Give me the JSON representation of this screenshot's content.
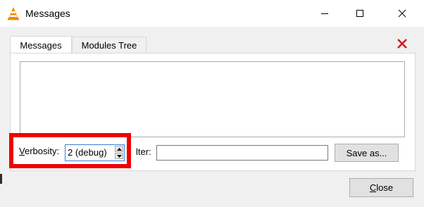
{
  "window": {
    "title": "Messages"
  },
  "tabs": [
    {
      "label": "Messages"
    },
    {
      "label": "Modules Tree"
    }
  ],
  "verbosity": {
    "label_underlined": "V",
    "label_rest": "erbosity:",
    "value": "2 (debug)"
  },
  "filter": {
    "label": "lter:",
    "value": ""
  },
  "buttons": {
    "save": "Save as...",
    "close_underlined": "C",
    "close_rest": "lose"
  },
  "colors": {
    "highlight": "#ee0000",
    "close_x": "#d11a1a"
  },
  "icons": {
    "app": "vlc-cone-icon",
    "dismiss": "red-x-icon"
  }
}
